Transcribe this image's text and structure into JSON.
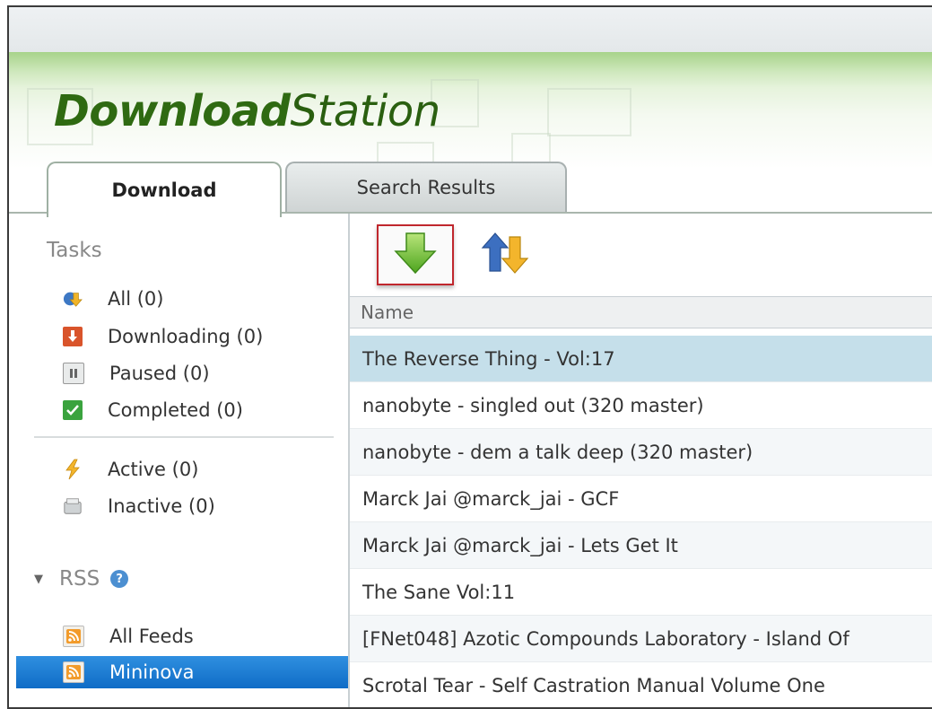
{
  "app": {
    "logo_bold": "Download",
    "logo_normal": "Station"
  },
  "tabs": [
    {
      "label": "Download",
      "active": true
    },
    {
      "label": "Search Results",
      "active": false
    }
  ],
  "sidebar": {
    "tasks_title": "Tasks",
    "tasks": [
      {
        "label": "All (0)",
        "icon": "all-tasks-icon"
      },
      {
        "label": "Downloading (0)",
        "icon": "downloading-icon"
      },
      {
        "label": "Paused (0)",
        "icon": "paused-icon"
      },
      {
        "label": "Completed (0)",
        "icon": "completed-icon"
      }
    ],
    "status": [
      {
        "label": "Active (0)",
        "icon": "active-icon"
      },
      {
        "label": "Inactive (0)",
        "icon": "inactive-icon"
      }
    ],
    "rss_title": "RSS",
    "feeds": [
      {
        "label": "All Feeds",
        "icon": "rss-icon"
      },
      {
        "label": "Mininova",
        "icon": "rss-icon",
        "selected": true
      }
    ]
  },
  "toolbar": {
    "download_button": "download-arrow-icon",
    "sort_button": "sort-arrows-icon"
  },
  "table": {
    "header": "Name",
    "rows": [
      "The Reverse Thing - Vol:17",
      "nanobyte - singled out (320 master)",
      "nanobyte - dem a talk deep (320 master)",
      "Marck Jai @marck_jai - GCF",
      "Marck Jai @marck_jai - Lets Get It",
      "The Sane Vol:11",
      "[FNet048] Azotic Compounds Laboratory - Island Of",
      "Scrotal Tear - Self Castration Manual Volume One"
    ]
  },
  "colors": {
    "accent_green": "#2f6a12",
    "selected_blue": "#1a7bd6",
    "row_highlight": "#c5dfea",
    "red_outline": "#c0272d"
  }
}
